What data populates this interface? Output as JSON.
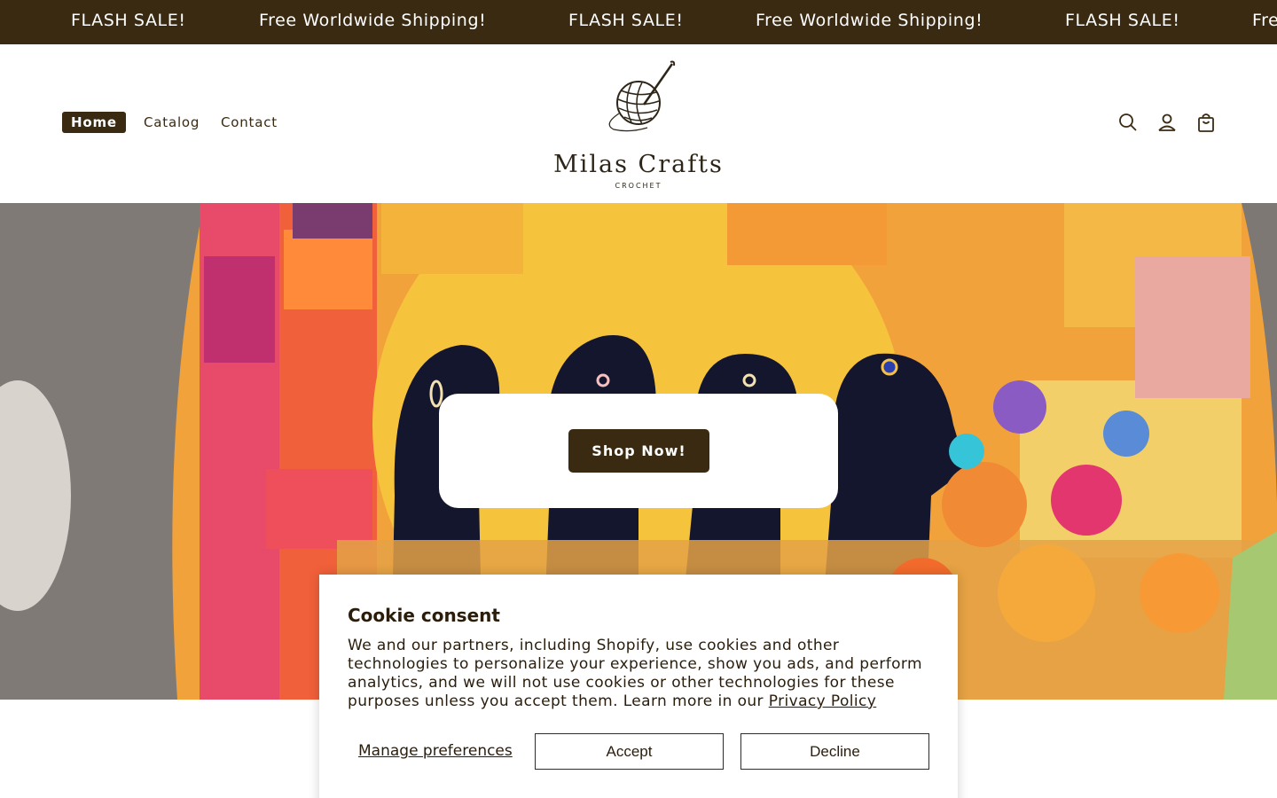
{
  "announcement": {
    "items": [
      "FLASH SALE!",
      "Free Worldwide Shipping!",
      "FLASH SALE!",
      "Free Worldwide Shipping!",
      "FLASH SALE!",
      "Free Worldwide Shipping!"
    ]
  },
  "header": {
    "nav": [
      {
        "label": "Home",
        "active": true
      },
      {
        "label": "Catalog",
        "active": false
      },
      {
        "label": "Contact",
        "active": false
      }
    ],
    "logo": {
      "title": "Milas Crafts",
      "subtitle": "CROCHET"
    },
    "icons": [
      "search-icon",
      "account-icon",
      "cart-icon"
    ]
  },
  "hero": {
    "button_label": "Shop Now!"
  },
  "cookie": {
    "title": "Cookie consent",
    "body": "We and our partners, including Shopify, use cookies and other technologies to personalize your experience, show you ads, and perform analytics, and we will not use cookies or other technologies for these purposes unless you accept them. Learn more in our",
    "link_label": "Privacy Policy",
    "manage_label": "Manage preferences",
    "accept_label": "Accept",
    "decline_label": "Decline"
  },
  "colors": {
    "brand_dark": "#3a2a12",
    "white": "#ffffff"
  }
}
